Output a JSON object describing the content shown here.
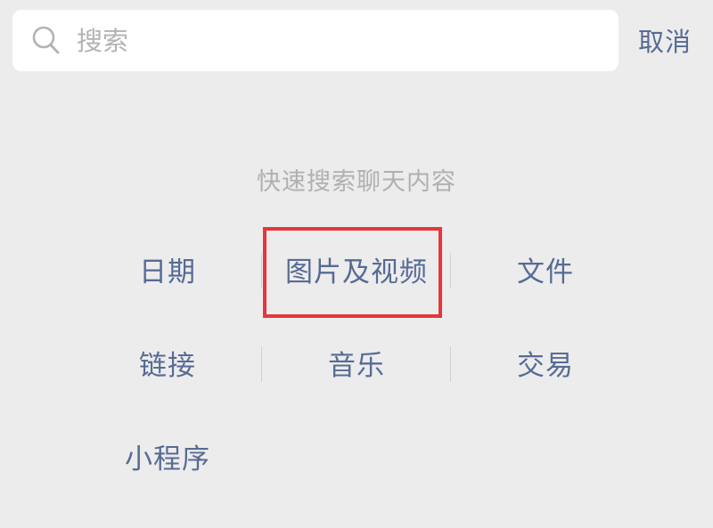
{
  "search": {
    "placeholder": "搜索",
    "value": ""
  },
  "cancel_label": "取消",
  "hint": "快速搜索聊天内容",
  "categories": [
    {
      "label": "日期"
    },
    {
      "label": "图片及视频"
    },
    {
      "label": "文件"
    },
    {
      "label": "链接"
    },
    {
      "label": "音乐"
    },
    {
      "label": "交易"
    },
    {
      "label": "小程序"
    }
  ],
  "highlight": {
    "target": "图片及视频",
    "color": "#e6363b"
  },
  "colors": {
    "accent": "#576b95",
    "background": "#ececec",
    "hint": "#b0b0b0"
  }
}
